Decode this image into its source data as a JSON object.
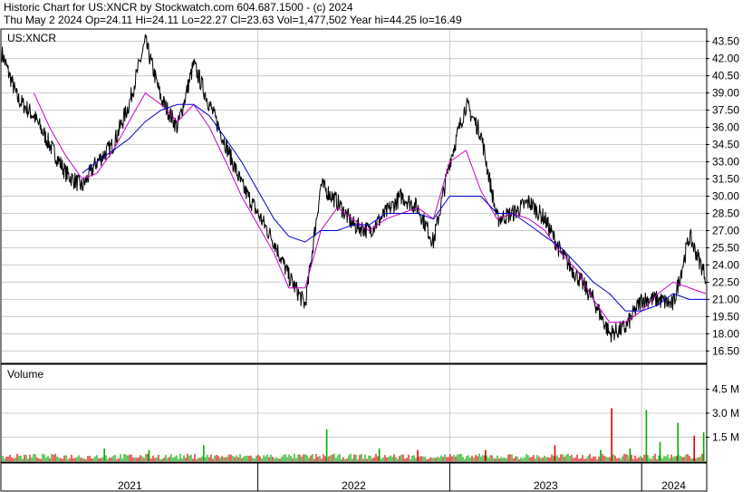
{
  "header": {
    "line1": "Historic Chart for US:XNCR by Stockwatch.com 604.687.1500 - (c) 2024",
    "line2": "Thu May  2 2024   Op=24.11   Hi=24.11   Lo=22.27   Cl=23.63   Vol=1,477,502   Year hi=44.25   lo=16.49"
  },
  "colors": {
    "price": "#000000",
    "ma_short": "#cc00cc",
    "ma_long": "#0000cc",
    "vol_up": "#00aa00",
    "vol_down": "#dd0000",
    "grid": "#cccccc"
  },
  "chart_data": [
    {
      "type": "line",
      "panel_label": "US:XNCR",
      "ylim": [
        15.5,
        44.5
      ],
      "y_ticks": [
        16.5,
        18.0,
        19.5,
        21.0,
        22.5,
        24.0,
        25.5,
        27.0,
        28.5,
        30.0,
        31.5,
        33.0,
        34.5,
        36.0,
        37.5,
        39.0,
        40.5,
        42.0,
        43.5
      ],
      "y_tick_labels": [
        "16.50",
        "18.00",
        "19.50",
        "21.00",
        "22.50",
        "24.00",
        "25.50",
        "27.00",
        "28.50",
        "30.00",
        "31.50",
        "33.00",
        "34.50",
        "36.00",
        "37.50",
        "39.00",
        "40.50",
        "42.00",
        "43.50"
      ],
      "x_labels": [
        "2021",
        "2022",
        "2023",
        "2024"
      ],
      "xlim": [
        "2020-09-01",
        "2024-05-02"
      ],
      "year_starts": [
        "2021-01-01",
        "2022-01-01",
        "2023-01-01",
        "2024-01-01"
      ],
      "grid": true,
      "series": [
        {
          "role": "price",
          "x": [
            "2020-09-01",
            "2020-10-01",
            "2020-11-01",
            "2020-12-01",
            "2021-01-01",
            "2021-02-01",
            "2021-03-01",
            "2021-04-01",
            "2021-05-01",
            "2021-06-01",
            "2021-07-01",
            "2021-08-01",
            "2021-09-01",
            "2021-10-01",
            "2021-11-01",
            "2021-12-01",
            "2022-01-01",
            "2022-02-01",
            "2022-03-01",
            "2022-04-01",
            "2022-05-01",
            "2022-06-01",
            "2022-07-01",
            "2022-08-01",
            "2022-09-01",
            "2022-10-01",
            "2022-11-01",
            "2022-12-01",
            "2023-01-01",
            "2023-02-01",
            "2023-03-01",
            "2023-04-01",
            "2023-05-01",
            "2023-06-01",
            "2023-07-01",
            "2023-08-01",
            "2023-09-01",
            "2023-10-01",
            "2023-11-01",
            "2023-12-01",
            "2024-01-01",
            "2024-02-01",
            "2024-03-01",
            "2024-04-01",
            "2024-05-02"
          ],
          "values": [
            42.5,
            38.5,
            37.0,
            34.5,
            32.0,
            30.8,
            33.0,
            34.5,
            38.0,
            43.5,
            38.5,
            36.0,
            41.5,
            38.0,
            34.5,
            31.0,
            28.5,
            26.0,
            23.0,
            20.5,
            31.0,
            29.5,
            27.5,
            27.0,
            28.5,
            30.0,
            29.0,
            26.0,
            33.0,
            38.0,
            35.5,
            28.0,
            28.5,
            29.5,
            28.0,
            25.0,
            23.0,
            21.0,
            18.0,
            18.5,
            21.0,
            21.0,
            20.5,
            26.5,
            23.0
          ]
        },
        {
          "role": "ma_short",
          "x": [
            "2020-11-01",
            "2020-12-01",
            "2021-01-01",
            "2021-02-01",
            "2021-03-01",
            "2021-04-01",
            "2021-05-01",
            "2021-06-01",
            "2021-07-01",
            "2021-08-01",
            "2021-09-01",
            "2021-10-01",
            "2021-11-01",
            "2021-12-01",
            "2022-01-01",
            "2022-02-01",
            "2022-03-01",
            "2022-04-01",
            "2022-05-01",
            "2022-06-01",
            "2022-07-01",
            "2022-08-01",
            "2022-09-01",
            "2022-10-01",
            "2022-11-01",
            "2022-12-01",
            "2023-01-01",
            "2023-02-01",
            "2023-03-01",
            "2023-04-01",
            "2023-05-01",
            "2023-06-01",
            "2023-07-01",
            "2023-08-01",
            "2023-09-01",
            "2023-10-01",
            "2023-11-01",
            "2023-12-01",
            "2024-01-01",
            "2024-02-01",
            "2024-03-01",
            "2024-04-01",
            "2024-05-02"
          ],
          "values": [
            39.0,
            36.0,
            33.5,
            31.5,
            32.0,
            34.0,
            36.5,
            39.0,
            38.0,
            36.5,
            38.0,
            36.0,
            33.0,
            30.0,
            27.5,
            25.0,
            22.0,
            22.0,
            27.0,
            29.0,
            28.0,
            27.0,
            28.0,
            28.5,
            29.0,
            28.0,
            33.0,
            34.0,
            30.5,
            28.0,
            28.5,
            28.0,
            27.0,
            25.0,
            23.5,
            21.0,
            19.0,
            19.0,
            20.0,
            21.5,
            22.5,
            22.0,
            21.5
          ]
        },
        {
          "role": "ma_long",
          "x": [
            "2021-02-01",
            "2021-03-01",
            "2021-04-01",
            "2021-05-01",
            "2021-06-01",
            "2021-07-01",
            "2021-08-01",
            "2021-09-01",
            "2021-10-01",
            "2021-11-01",
            "2021-12-01",
            "2022-01-01",
            "2022-02-01",
            "2022-03-01",
            "2022-04-01",
            "2022-05-01",
            "2022-06-01",
            "2022-07-01",
            "2022-08-01",
            "2022-09-01",
            "2022-10-01",
            "2022-11-01",
            "2022-12-01",
            "2023-01-01",
            "2023-02-01",
            "2023-03-01",
            "2023-04-01",
            "2023-05-01",
            "2023-06-01",
            "2023-07-01",
            "2023-08-01",
            "2023-09-01",
            "2023-10-01",
            "2023-11-01",
            "2023-12-01",
            "2024-01-01",
            "2024-02-01",
            "2024-03-01",
            "2024-04-01",
            "2024-05-02"
          ],
          "values": [
            32.0,
            33.0,
            34.0,
            35.0,
            36.5,
            37.5,
            38.0,
            38.0,
            37.0,
            35.0,
            33.0,
            30.5,
            28.0,
            26.5,
            26.0,
            27.0,
            27.0,
            27.5,
            27.5,
            28.5,
            28.5,
            28.5,
            28.0,
            30.0,
            30.0,
            30.0,
            28.5,
            28.5,
            27.5,
            26.5,
            25.5,
            24.0,
            22.5,
            21.5,
            20.0,
            20.0,
            20.5,
            21.5,
            21.0,
            21.0
          ]
        }
      ]
    },
    {
      "type": "bar",
      "panel_label": "Volume",
      "ylim": [
        0,
        6.0
      ],
      "y_ticks": [
        1.5,
        3.0,
        4.5
      ],
      "y_tick_labels": [
        "1.5 M",
        "3.0 M",
        "4.5 M"
      ],
      "spikes": [
        {
          "x": "2021-03-15",
          "value": 0.8,
          "up": true
        },
        {
          "x": "2021-06-08",
          "value": 0.7,
          "up": true
        },
        {
          "x": "2021-09-20",
          "value": 1.0,
          "up": true
        },
        {
          "x": "2022-05-12",
          "value": 2.0,
          "up": true
        },
        {
          "x": "2022-08-20",
          "value": 0.8,
          "up": true
        },
        {
          "x": "2022-11-01",
          "value": 0.7,
          "up": false
        },
        {
          "x": "2023-03-10",
          "value": 0.7,
          "up": false
        },
        {
          "x": "2023-07-20",
          "value": 1.0,
          "up": false
        },
        {
          "x": "2023-10-15",
          "value": 0.7,
          "up": true
        },
        {
          "x": "2023-11-05",
          "value": 3.3,
          "up": false
        },
        {
          "x": "2023-12-10",
          "value": 0.8,
          "up": true
        },
        {
          "x": "2024-01-10",
          "value": 3.2,
          "up": true
        },
        {
          "x": "2024-02-05",
          "value": 1.2,
          "up": true
        },
        {
          "x": "2024-03-10",
          "value": 2.4,
          "up": true
        },
        {
          "x": "2024-04-10",
          "value": 1.6,
          "up": false
        },
        {
          "x": "2024-04-28",
          "value": 1.8,
          "up": true
        }
      ]
    }
  ]
}
